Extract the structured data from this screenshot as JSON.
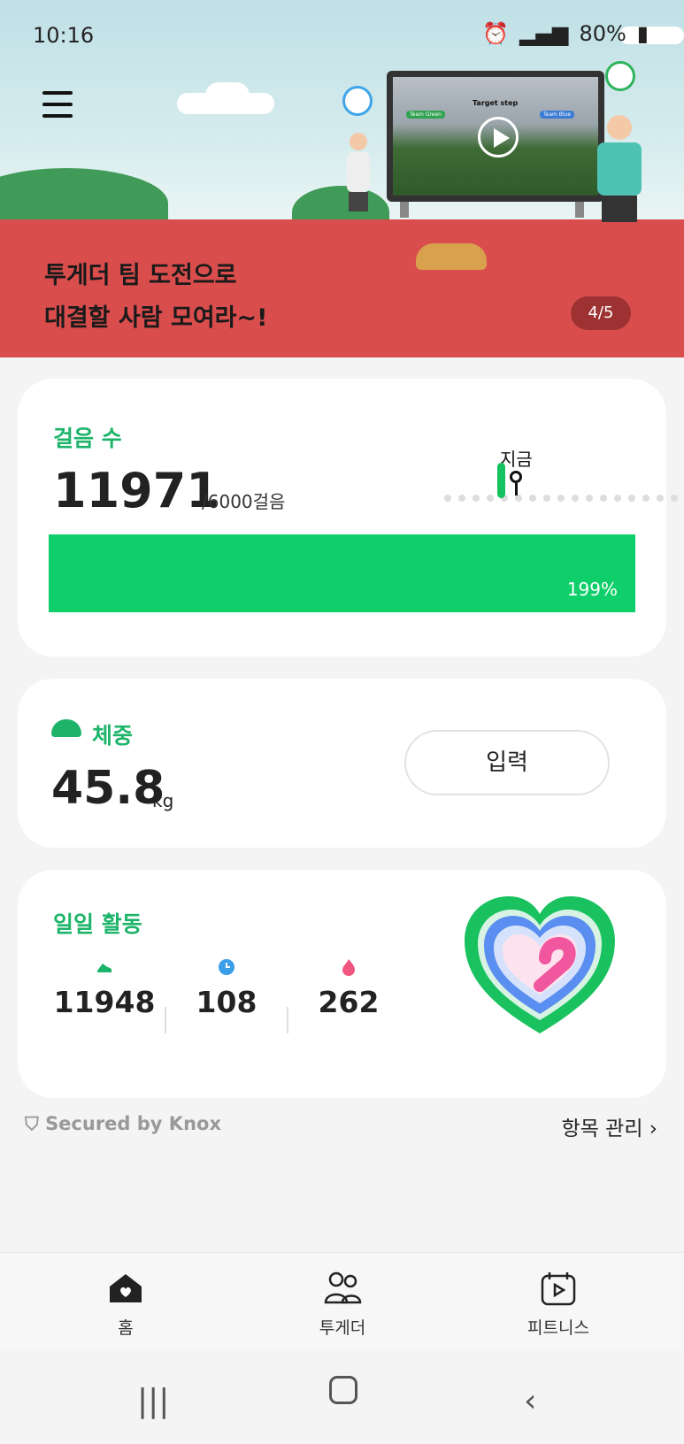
{
  "status_bar": {
    "time": "10:16",
    "battery": "80%"
  },
  "banner": {
    "line1": "투게더 팀 도전으로",
    "line2": "대결할 사람 모여라~!",
    "page_indicator": "4/5",
    "screen_title": "Target step",
    "team_left": "Team Green",
    "team_right": "Team Blue"
  },
  "steps": {
    "title": "걸음 수",
    "value": "11971",
    "goal": "/6000걸음",
    "now_label": "지금",
    "percent_label": "199%",
    "progress_fraction": 1.0
  },
  "weight": {
    "title": "체중",
    "value": "45.8",
    "unit": "kg",
    "input_label": "입력"
  },
  "daily": {
    "title": "일일 활동",
    "steps": "11948",
    "minutes": "108",
    "calories": "262"
  },
  "footer": {
    "knox": "Secured by Knox",
    "manage": "항목 관리"
  },
  "nav": {
    "home": "홈",
    "together": "투게더",
    "fitness": "피트니스"
  },
  "colors": {
    "accent": "#1db46a",
    "progress": "#0fcf6b",
    "banner_track": "#d94d4d"
  }
}
